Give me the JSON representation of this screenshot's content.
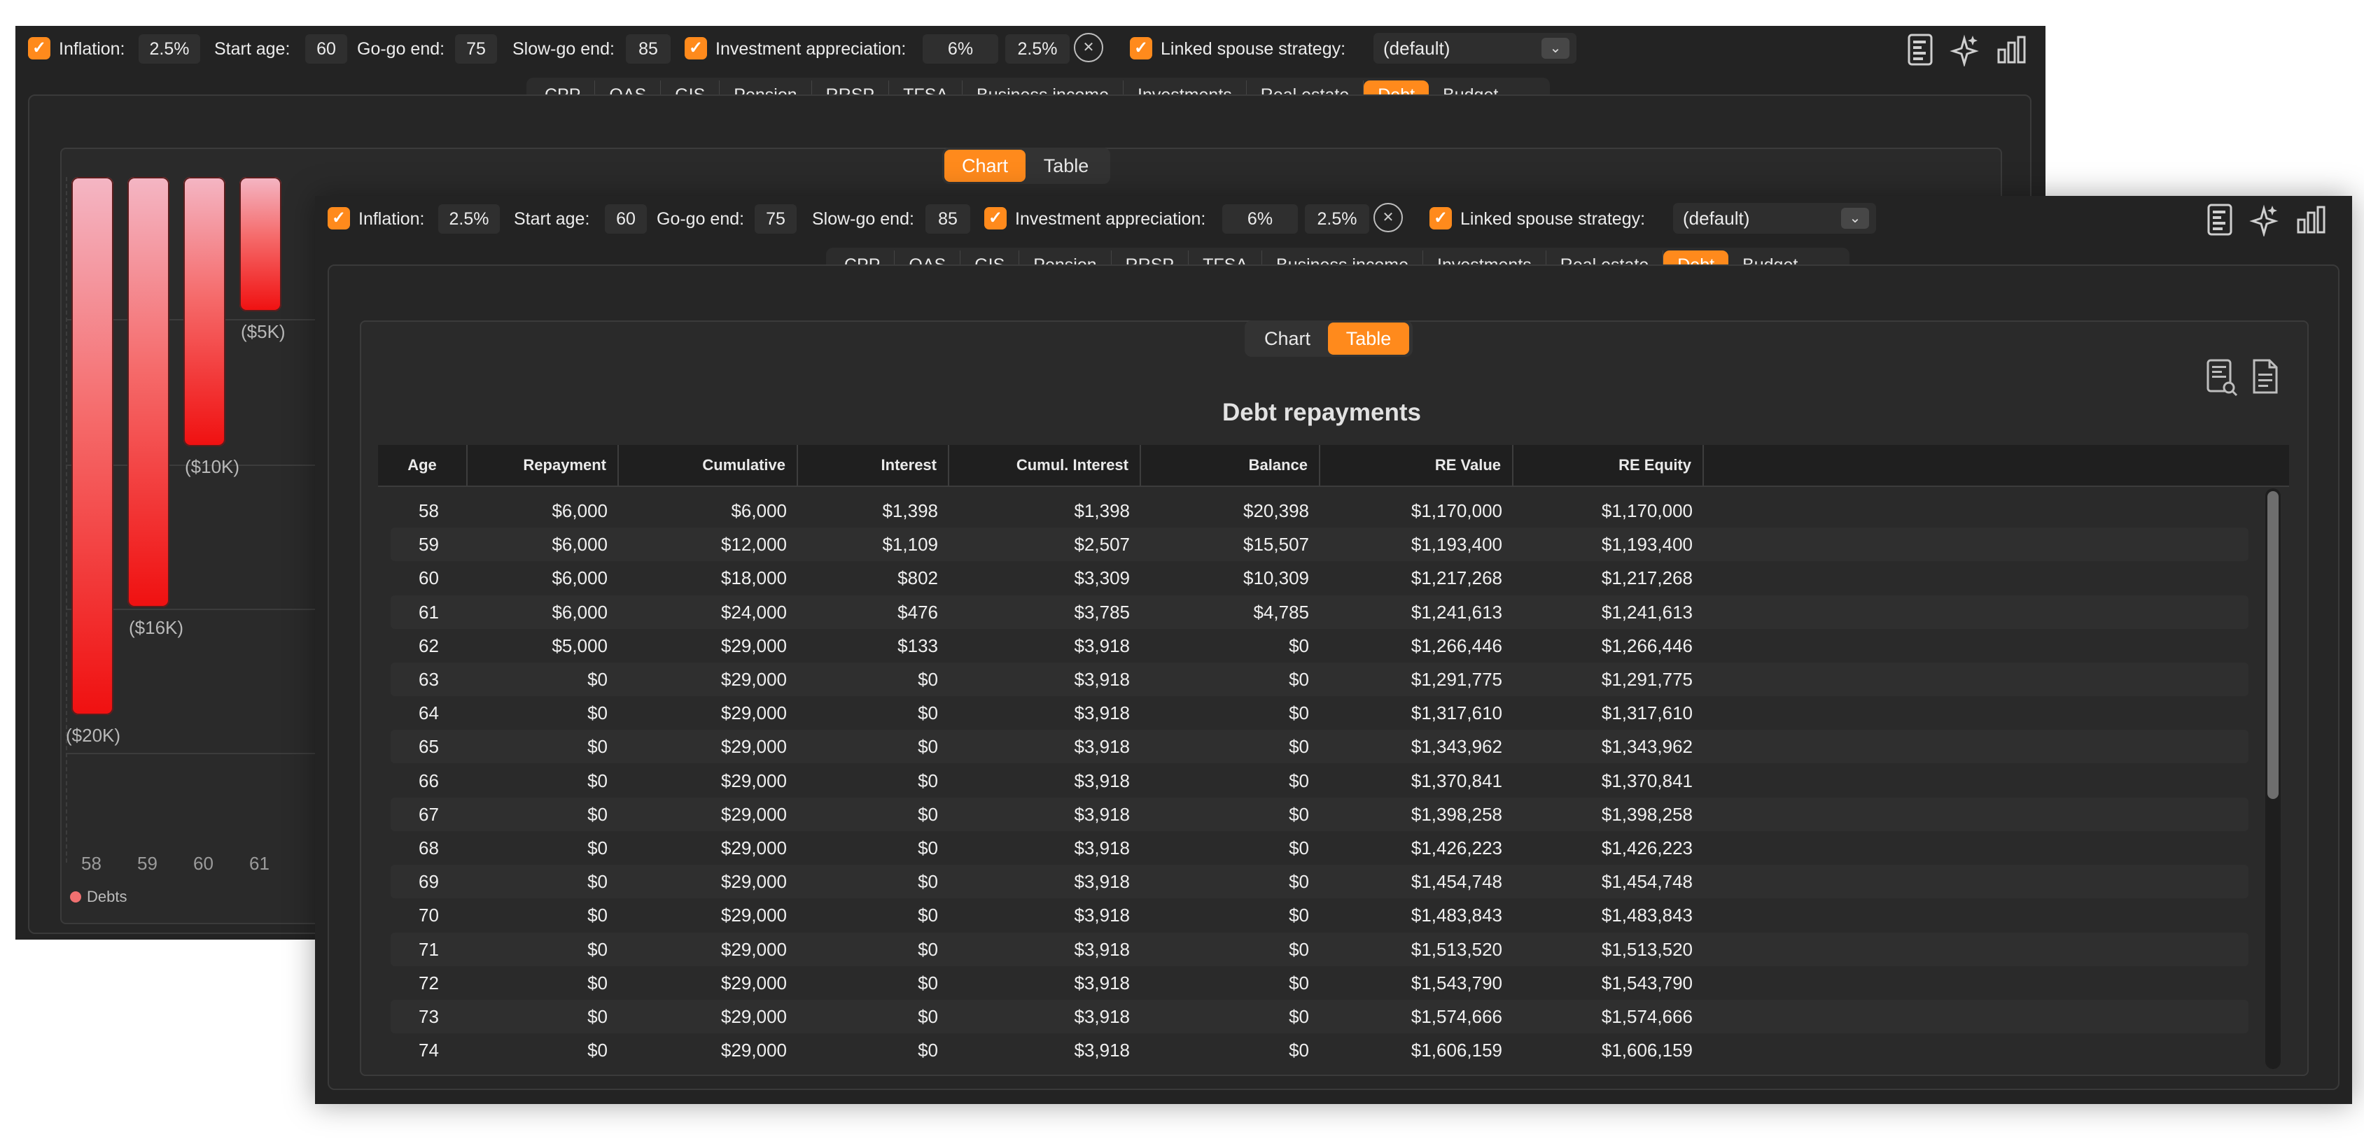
{
  "toolbar": {
    "inflation_label": "Inflation:",
    "inflation_value": "2.5%",
    "start_age_label": "Start age:",
    "start_age_value": "60",
    "gogo_label": "Go-go end:",
    "gogo_value": "75",
    "slowgo_label": "Slow-go end:",
    "slowgo_value": "85",
    "invest_label": "Investment appreciation:",
    "invest_value": "6%",
    "invest_value2": "2.5%",
    "spouse_label": "Linked spouse strategy:",
    "spouse_value": "(default)",
    "icons": [
      "report-icon",
      "sparkle-icon",
      "bar-chart-icon"
    ]
  },
  "tabs": [
    "CPP",
    "OAS",
    "GIS",
    "Pension",
    "RRSP",
    "TFSA",
    "Business income",
    "Investments",
    "Real estate",
    "Debt",
    "Budget"
  ],
  "active_tab": "Debt",
  "view_toggle": {
    "chart": "Chart",
    "table": "Table"
  },
  "chart_data": {
    "type": "bar",
    "categories": [
      "58",
      "59",
      "60",
      "61"
    ],
    "values": [
      -20000,
      -16000,
      -10000,
      -5000
    ],
    "value_labels": [
      "($20K)",
      "($16K)",
      "($10K)",
      "($5K)"
    ],
    "partial_tick": "6",
    "legend": [
      "Debts"
    ],
    "colors": {
      "debts": "#f01010"
    }
  },
  "table": {
    "title": "Debt repayments",
    "columns": [
      "Age",
      "Repayment",
      "Cumulative",
      "Interest",
      "Cumul. Interest",
      "Balance",
      "RE Value",
      "RE Equity"
    ],
    "rows": [
      [
        "58",
        "$6,000",
        "$6,000",
        "$1,398",
        "$1,398",
        "$20,398",
        "$1,170,000",
        "$1,170,000"
      ],
      [
        "59",
        "$6,000",
        "$12,000",
        "$1,109",
        "$2,507",
        "$15,507",
        "$1,193,400",
        "$1,193,400"
      ],
      [
        "60",
        "$6,000",
        "$18,000",
        "$802",
        "$3,309",
        "$10,309",
        "$1,217,268",
        "$1,217,268"
      ],
      [
        "61",
        "$6,000",
        "$24,000",
        "$476",
        "$3,785",
        "$4,785",
        "$1,241,613",
        "$1,241,613"
      ],
      [
        "62",
        "$5,000",
        "$29,000",
        "$133",
        "$3,918",
        "$0",
        "$1,266,446",
        "$1,266,446"
      ],
      [
        "63",
        "$0",
        "$29,000",
        "$0",
        "$3,918",
        "$0",
        "$1,291,775",
        "$1,291,775"
      ],
      [
        "64",
        "$0",
        "$29,000",
        "$0",
        "$3,918",
        "$0",
        "$1,317,610",
        "$1,317,610"
      ],
      [
        "65",
        "$0",
        "$29,000",
        "$0",
        "$3,918",
        "$0",
        "$1,343,962",
        "$1,343,962"
      ],
      [
        "66",
        "$0",
        "$29,000",
        "$0",
        "$3,918",
        "$0",
        "$1,370,841",
        "$1,370,841"
      ],
      [
        "67",
        "$0",
        "$29,000",
        "$0",
        "$3,918",
        "$0",
        "$1,398,258",
        "$1,398,258"
      ],
      [
        "68",
        "$0",
        "$29,000",
        "$0",
        "$3,918",
        "$0",
        "$1,426,223",
        "$1,426,223"
      ],
      [
        "69",
        "$0",
        "$29,000",
        "$0",
        "$3,918",
        "$0",
        "$1,454,748",
        "$1,454,748"
      ],
      [
        "70",
        "$0",
        "$29,000",
        "$0",
        "$3,918",
        "$0",
        "$1,483,843",
        "$1,483,843"
      ],
      [
        "71",
        "$0",
        "$29,000",
        "$0",
        "$3,918",
        "$0",
        "$1,513,520",
        "$1,513,520"
      ],
      [
        "72",
        "$0",
        "$29,000",
        "$0",
        "$3,918",
        "$0",
        "$1,543,790",
        "$1,543,790"
      ],
      [
        "73",
        "$0",
        "$29,000",
        "$0",
        "$3,918",
        "$0",
        "$1,574,666",
        "$1,574,666"
      ],
      [
        "74",
        "$0",
        "$29,000",
        "$0",
        "$3,918",
        "$0",
        "$1,606,159",
        "$1,606,159"
      ]
    ]
  },
  "table_icons": [
    "search-report-icon",
    "document-icon"
  ]
}
